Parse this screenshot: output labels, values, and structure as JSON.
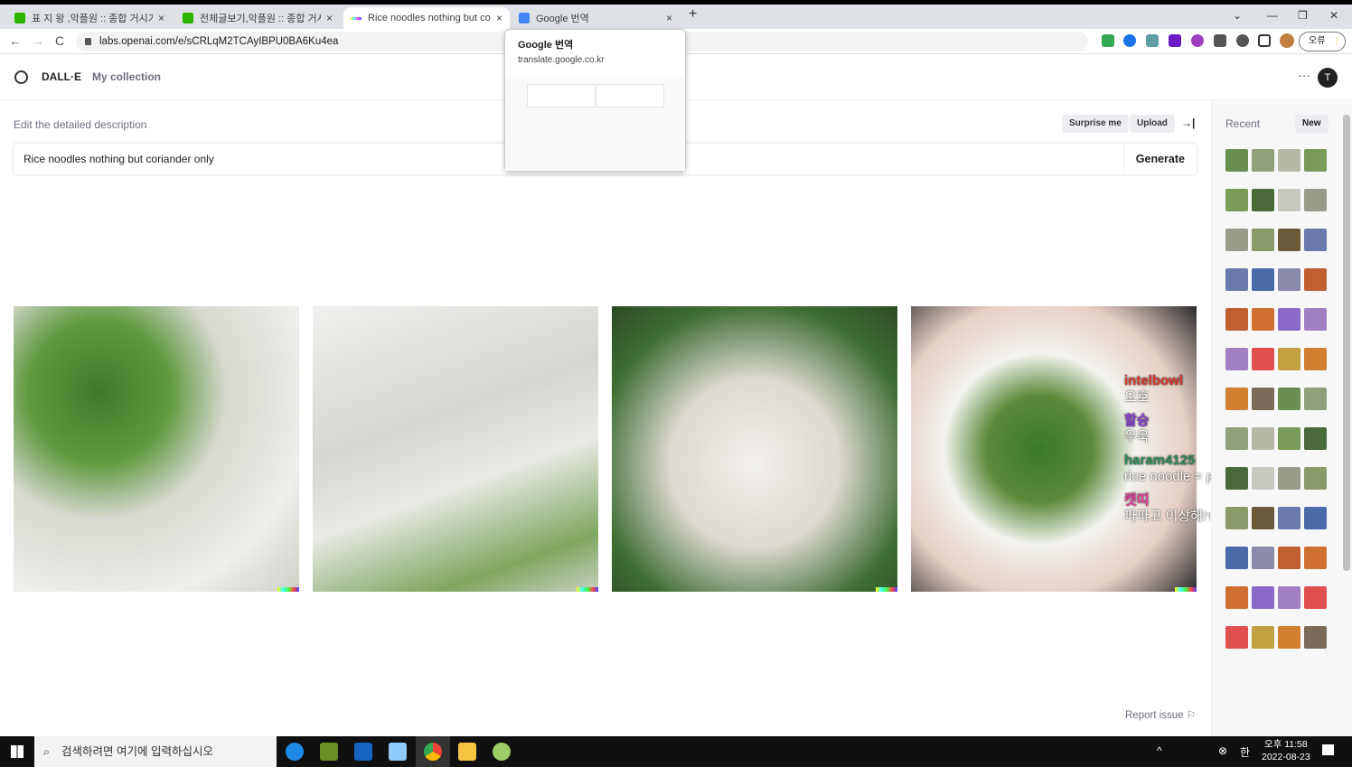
{
  "browser": {
    "tabs": [
      {
        "title": "표 지 왕 ,악플원 :: 종합 거시기 ::",
        "fav": "#2db400"
      },
      {
        "title": "전체글보기,악플원 :: 종합 거시기",
        "fav": "#2db400"
      },
      {
        "title": "Rice noodles nothing but coriander only",
        "fav": "#888"
      },
      {
        "title": "Google 번역",
        "fav": "#4285f4"
      }
    ],
    "url": "labs.openai.com/e/sCRLqM2TCAyIBPU0BA6Ku4ea",
    "profile_button": "오류",
    "new_tab": "+",
    "close": "×",
    "back": "←",
    "forward": "→",
    "reload": "C",
    "minimize": "—",
    "maximize": "❐",
    "window_close": "✕",
    "tab_list": "⌄"
  },
  "hover_card": {
    "title": "Google 번역",
    "domain": "translate.google.co.kr"
  },
  "app": {
    "brand": "DALL·E",
    "collection": "My collection",
    "more": "···",
    "avatar": "T"
  },
  "editor": {
    "label": "Edit the detailed description",
    "surprise": "Surprise me",
    "upload": "Upload",
    "collapse": "→|",
    "prompt": "Rice noodles nothing but coriander only",
    "generate": "Generate",
    "report": "Report issue"
  },
  "images": [
    {
      "alt": "noodles with green onion"
    },
    {
      "alt": "plain rice noodles"
    },
    {
      "alt": "noodles with greens"
    },
    {
      "alt": "bowl of noodle soup with coriander"
    }
  ],
  "chat_overlay": [
    {
      "user": "intelbowl",
      "msg": "오호",
      "color": "#d93a2b"
    },
    {
      "user": "할승",
      "msg": "우욱",
      "color": "#8a3fd1"
    },
    {
      "user": "haram4125",
      "msg": "rice noodle = pho",
      "color": "#2e8b57"
    },
    {
      "user": "캣띠",
      "msg": "파파고 이상해!ㅠ",
      "color": "#e0409a"
    }
  ],
  "sidebar": {
    "title": "Recent",
    "new": "New"
  },
  "taskbar": {
    "search": "검색하려면 여기에 입력하십시오",
    "time": "오후 11:58",
    "date": "2022-08-23",
    "ime": "한"
  }
}
